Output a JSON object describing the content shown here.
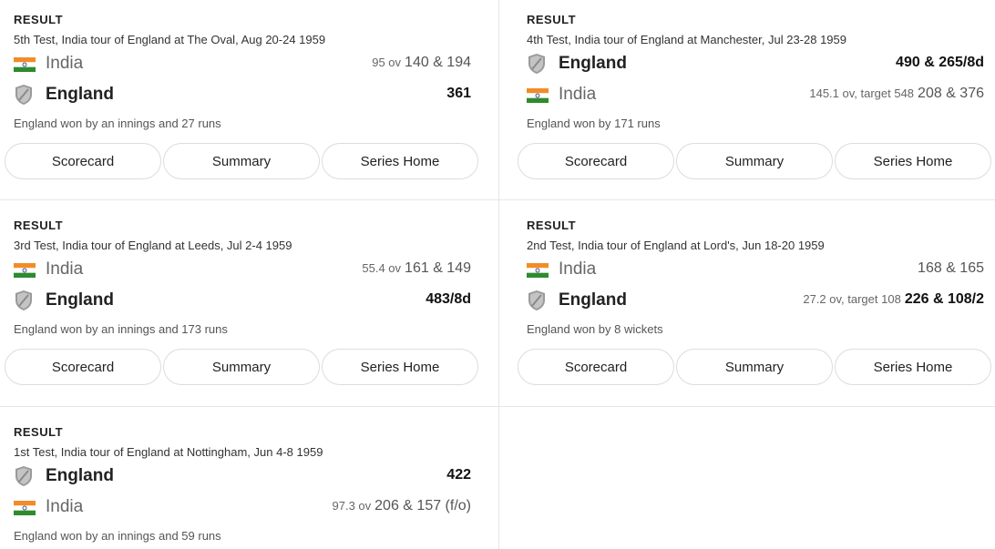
{
  "buttons": {
    "scorecard": "Scorecard",
    "summary": "Summary",
    "series_home": "Series Home"
  },
  "matches": [
    {
      "status": "RESULT",
      "description": "5th Test, India tour of England at The Oval, Aug 20-24 1959",
      "teams": [
        {
          "name": "India",
          "overs": "95 ov",
          "score": "140 & 194",
          "winner": false,
          "flag": "india-flag-icon"
        },
        {
          "name": "England",
          "overs": "",
          "score": "361",
          "winner": true,
          "flag": "england-crest-icon"
        }
      ],
      "result": "England won by an innings and 27 runs"
    },
    {
      "status": "RESULT",
      "description": "4th Test, India tour of England at Manchester, Jul 23-28 1959",
      "teams": [
        {
          "name": "England",
          "overs": "",
          "score": "490 & 265/8d",
          "winner": true,
          "flag": "england-crest-icon"
        },
        {
          "name": "India",
          "overs": "145.1 ov, target 548",
          "score": "208 & 376",
          "winner": false,
          "flag": "india-flag-icon"
        }
      ],
      "result": "England won by 171 runs"
    },
    {
      "status": "RESULT",
      "description": "3rd Test, India tour of England at Leeds, Jul 2-4 1959",
      "teams": [
        {
          "name": "India",
          "overs": "55.4 ov",
          "score": "161 & 149",
          "winner": false,
          "flag": "india-flag-icon"
        },
        {
          "name": "England",
          "overs": "",
          "score": "483/8d",
          "winner": true,
          "flag": "england-crest-icon"
        }
      ],
      "result": "England won by an innings and 173 runs"
    },
    {
      "status": "RESULT",
      "description": "2nd Test, India tour of England at Lord's, Jun 18-20 1959",
      "teams": [
        {
          "name": "India",
          "overs": "",
          "score": "168 & 165",
          "winner": false,
          "flag": "india-flag-icon"
        },
        {
          "name": "England",
          "overs": "27.2 ov, target 108",
          "score": "226 & 108/2",
          "winner": true,
          "flag": "england-crest-icon"
        }
      ],
      "result": "England won by 8 wickets"
    },
    {
      "status": "RESULT",
      "description": "1st Test, India tour of England at Nottingham, Jun 4-8 1959",
      "teams": [
        {
          "name": "England",
          "overs": "",
          "score": "422",
          "winner": true,
          "flag": "england-crest-icon"
        },
        {
          "name": "India",
          "overs": "97.3 ov",
          "score": "206 & 157 (f/o)",
          "winner": false,
          "flag": "india-flag-icon"
        }
      ],
      "result": "England won by an innings and 59 runs"
    }
  ]
}
